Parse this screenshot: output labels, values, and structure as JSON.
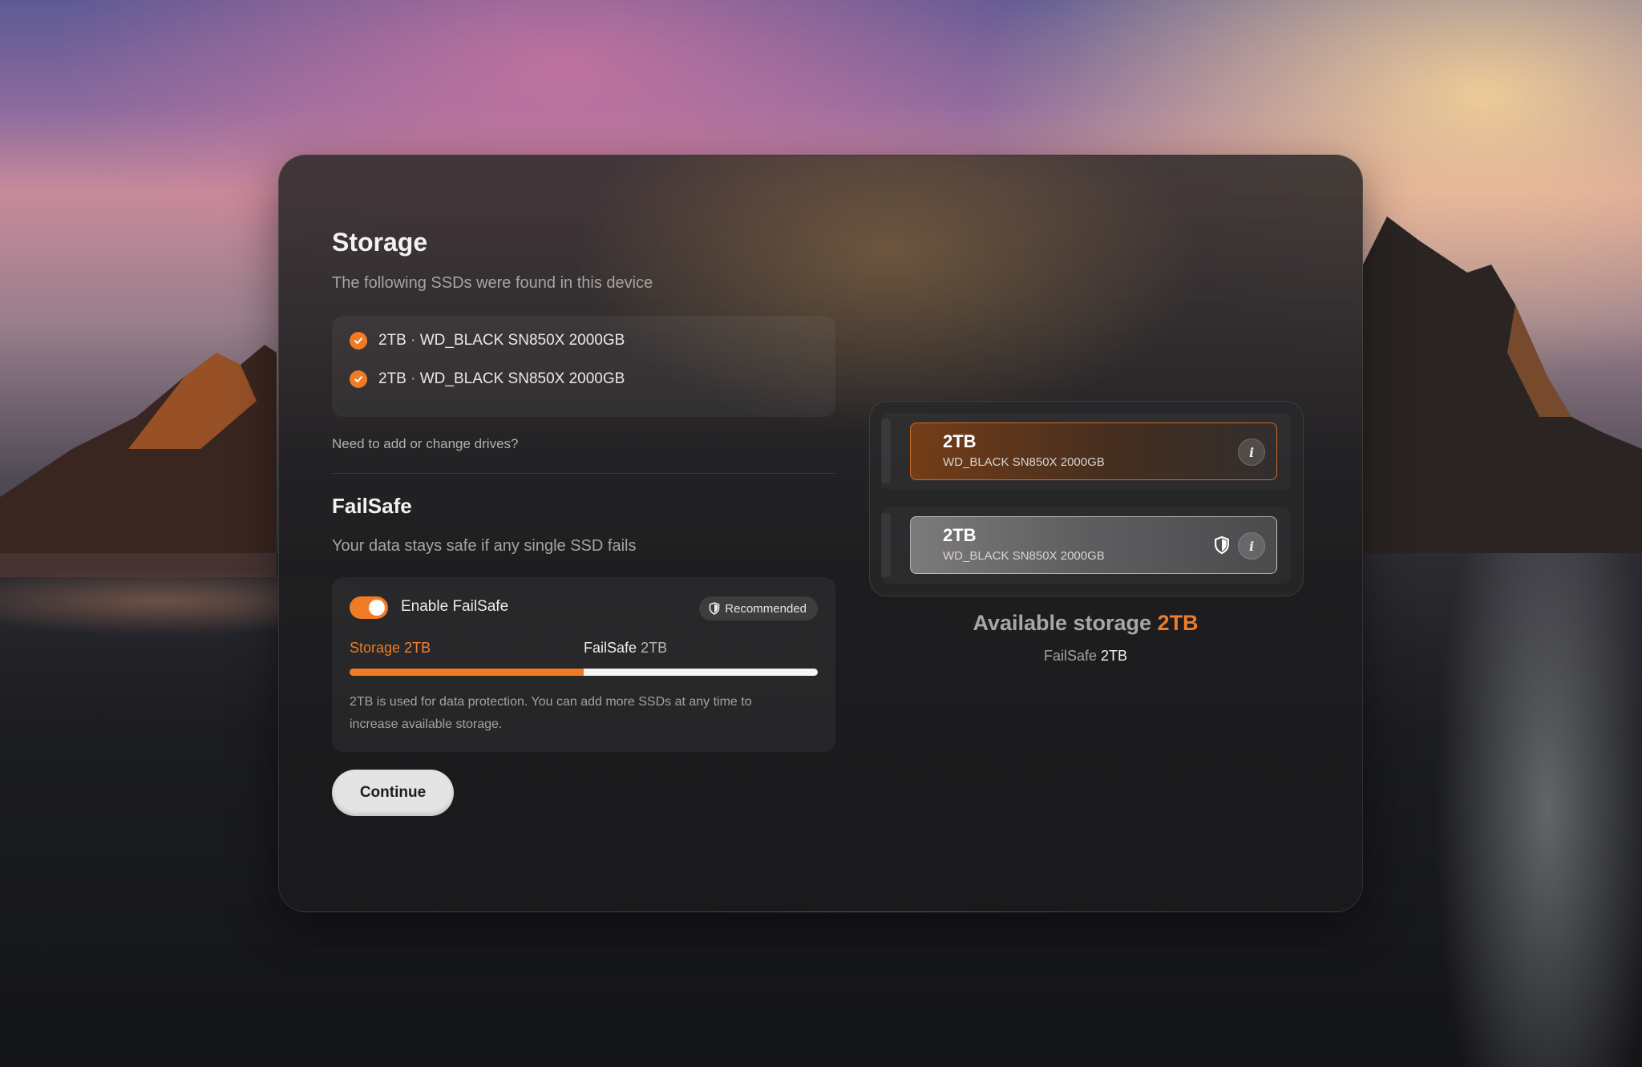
{
  "storage": {
    "title": "Storage",
    "subtitle": "The following SSDs were found in this device",
    "drives": [
      {
        "size": "2TB",
        "separator": "·",
        "model": "WD_BLACK SN850X 2000GB",
        "checked": true
      },
      {
        "size": "2TB",
        "separator": "·",
        "model": "WD_BLACK SN850X 2000GB",
        "checked": true
      }
    ],
    "change_link": "Need to add or change drives?"
  },
  "failsafe": {
    "title": "FailSafe",
    "subtitle": "Your data stays safe if any single SSD fails",
    "toggle_label": "Enable FailSafe",
    "toggle_on": true,
    "badge": "Recommended",
    "storage_label": "Storage",
    "storage_value": "2TB",
    "failsafe_label": "FailSafe",
    "failsafe_value": "2TB",
    "storage_fraction": 0.5,
    "note": "2TB is used for data protection. You can add more SSDs at any time to increase available storage."
  },
  "continue_label": "Continue",
  "ssd_slots": [
    {
      "size": "2TB",
      "model": "WD_BLACK SN850X 2000GB",
      "role": "storage",
      "info": "i"
    },
    {
      "size": "2TB",
      "model": "WD_BLACK SN850X 2000GB",
      "role": "failsafe",
      "info": "i"
    }
  ],
  "summary": {
    "available_label": "Available storage",
    "available_value": "2TB",
    "failsafe_label": "FailSafe",
    "failsafe_value": "2TB"
  },
  "colors": {
    "accent": "#f07b24"
  },
  "icons": [
    "check-icon",
    "shield-icon",
    "info-icon"
  ]
}
